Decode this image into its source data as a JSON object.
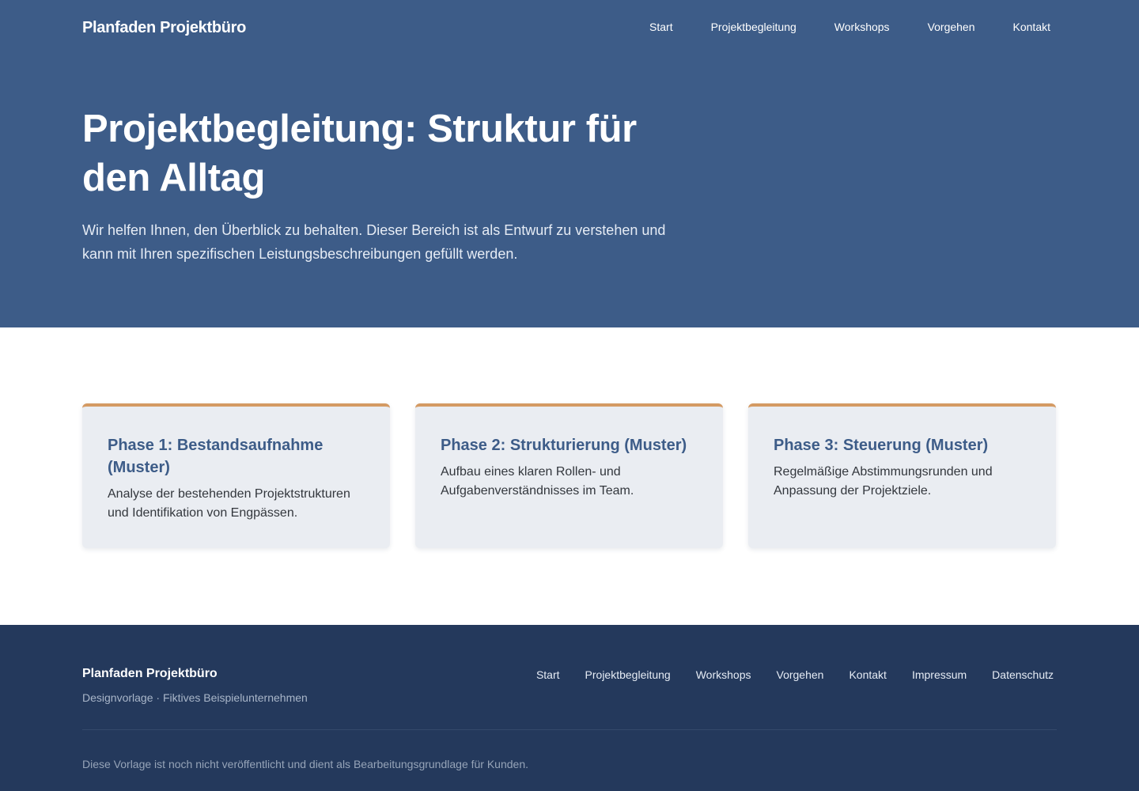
{
  "header": {
    "brand": "Planfaden Projektbüro",
    "nav": [
      "Start",
      "Projektbegleitung",
      "Workshops",
      "Vorgehen",
      "Kontakt"
    ]
  },
  "hero": {
    "title": "Projektbegleitung: Struktur für den Alltag",
    "intro": "Wir helfen Ihnen, den Überblick zu behalten. Dieser Bereich ist als Entwurf zu verstehen und kann mit Ihren spezifischen Leistungsbeschreibungen gefüllt werden."
  },
  "cards": [
    {
      "title": "Phase 1: Bestandsaufnahme (Muster)",
      "text": "Analyse der bestehenden Projektstrukturen und Identifikation von Engpässen."
    },
    {
      "title": "Phase 2: Strukturierung (Muster)",
      "text": "Aufbau eines klaren Rollen- und Aufgabenverständnisses im Team."
    },
    {
      "title": "Phase 3: Steuerung (Muster)",
      "text": "Regelmäßige Abstimmungsrunden und Anpassung der Projektziele."
    }
  ],
  "footer": {
    "brand": "Planfaden Projektbüro",
    "tagline": "Designvorlage · Fiktives Beispielunternehmen",
    "nav": [
      "Start",
      "Projektbegleitung",
      "Workshops",
      "Vorgehen",
      "Kontakt",
      "Impressum",
      "Datenschutz"
    ],
    "note": "Diese Vorlage ist noch nicht veröffentlicht und dient als Bearbeitungsgrundlage für Kunden."
  },
  "colors": {
    "hero_bg": "#3d5c88",
    "footer_bg": "#24395c",
    "accent": "#d49a63",
    "card_bg": "#eaedf2",
    "card_title": "#3d5c88"
  }
}
